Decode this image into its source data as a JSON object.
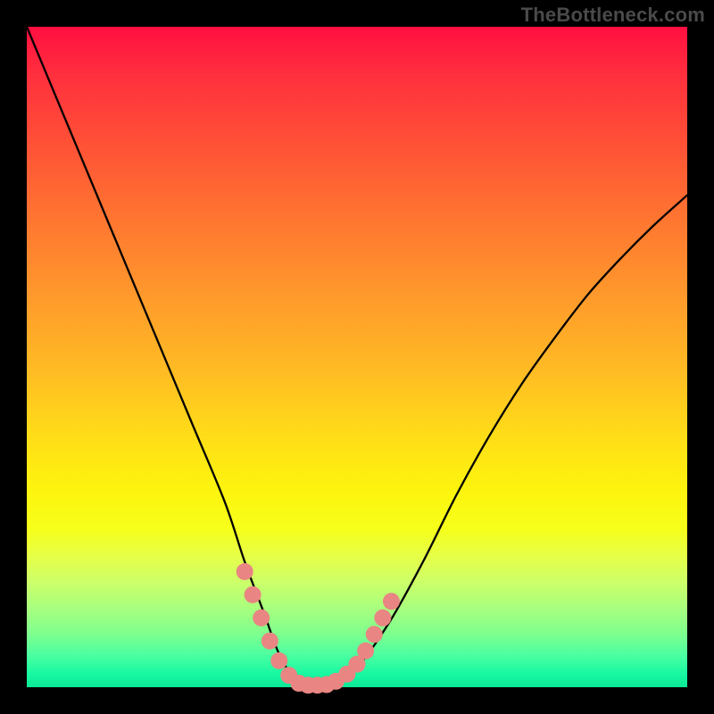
{
  "watermark": "TheBottleneck.com",
  "chart_data": {
    "type": "line",
    "title": "",
    "xlabel": "",
    "ylabel": "",
    "xlim": [
      0,
      100
    ],
    "ylim": [
      0,
      100
    ],
    "series": [
      {
        "name": "bottleneck-curve",
        "x": [
          0,
          5,
          10,
          15,
          20,
          25,
          30,
          33,
          36,
          38,
          40,
          42,
          44,
          46.5,
          50,
          55,
          60,
          65,
          70,
          75,
          80,
          85,
          90,
          95,
          100
        ],
        "y": [
          100,
          88,
          76,
          64,
          52,
          40,
          28,
          19,
          11,
          5.5,
          2,
          0.7,
          0.3,
          0.7,
          3,
          10,
          19,
          29,
          38,
          46,
          53,
          59.5,
          65,
          70,
          74.5
        ]
      }
    ],
    "marker_cluster": {
      "comment": "salmon dots near the valley",
      "points": [
        {
          "x": 33.0,
          "y": 17.5
        },
        {
          "x": 34.2,
          "y": 14.0
        },
        {
          "x": 35.5,
          "y": 10.5
        },
        {
          "x": 36.8,
          "y": 7.0
        },
        {
          "x": 38.2,
          "y": 4.0
        },
        {
          "x": 39.7,
          "y": 1.8
        },
        {
          "x": 41.2,
          "y": 0.6
        },
        {
          "x": 42.6,
          "y": 0.3
        },
        {
          "x": 44.0,
          "y": 0.3
        },
        {
          "x": 45.4,
          "y": 0.4
        },
        {
          "x": 46.8,
          "y": 0.9
        },
        {
          "x": 48.5,
          "y": 2.0
        },
        {
          "x": 50.0,
          "y": 3.5
        },
        {
          "x": 51.3,
          "y": 5.5
        },
        {
          "x": 52.6,
          "y": 8.0
        },
        {
          "x": 53.9,
          "y": 10.5
        },
        {
          "x": 55.2,
          "y": 13.0
        }
      ]
    },
    "gradient_stops": [
      {
        "pos": 0.0,
        "color": "#ff0e40"
      },
      {
        "pos": 0.3,
        "color": "#ff7830"
      },
      {
        "pos": 0.62,
        "color": "#ffdd18"
      },
      {
        "pos": 0.8,
        "color": "#e7ff46"
      },
      {
        "pos": 1.0,
        "color": "#0be896"
      }
    ],
    "marker_color": "#e98582",
    "curve_color": "#000000"
  }
}
